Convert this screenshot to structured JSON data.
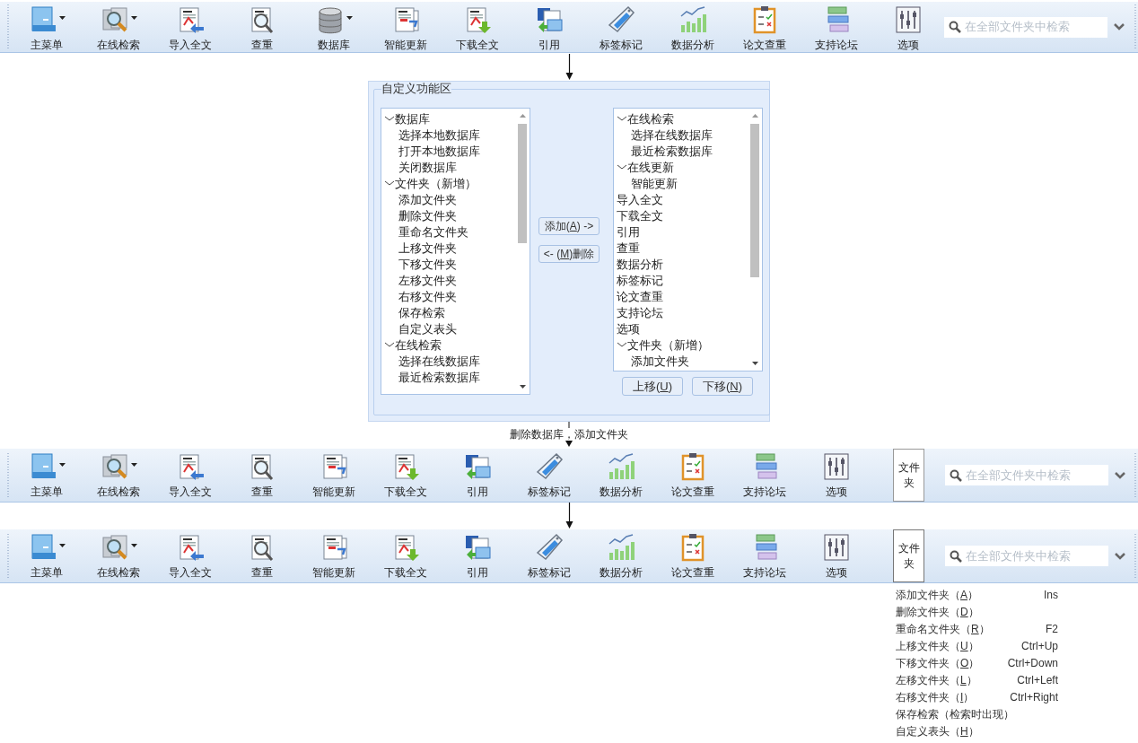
{
  "toolbars": [
    {
      "items": [
        {
          "kind": "menu",
          "label": "主菜单",
          "dropdown": true
        },
        {
          "kind": "online",
          "label": "在线检索",
          "dropdown": true
        },
        {
          "kind": "import",
          "label": "导入全文",
          "dropdown": false
        },
        {
          "kind": "check",
          "label": "查重",
          "dropdown": false
        },
        {
          "kind": "database",
          "label": "数据库",
          "dropdown": true
        },
        {
          "kind": "update",
          "label": "智能更新",
          "dropdown": false
        },
        {
          "kind": "download",
          "label": "下载全文",
          "dropdown": false
        },
        {
          "kind": "cite",
          "label": "引用",
          "dropdown": false
        },
        {
          "kind": "tag",
          "label": "标签标记",
          "dropdown": false
        },
        {
          "kind": "analysis",
          "label": "数据分析",
          "dropdown": false
        },
        {
          "kind": "paper",
          "label": "论文查重",
          "dropdown": false
        },
        {
          "kind": "forum",
          "label": "支持论坛",
          "dropdown": false
        },
        {
          "kind": "options",
          "label": "选项",
          "dropdown": false
        }
      ],
      "search": {
        "placeholder": "在全部文件夹中检索"
      }
    },
    {
      "items": [
        {
          "kind": "menu",
          "label": "主菜单",
          "dropdown": true
        },
        {
          "kind": "online",
          "label": "在线检索",
          "dropdown": true
        },
        {
          "kind": "import",
          "label": "导入全文",
          "dropdown": false
        },
        {
          "kind": "check",
          "label": "查重",
          "dropdown": false
        },
        {
          "kind": "update",
          "label": "智能更新",
          "dropdown": false
        },
        {
          "kind": "download",
          "label": "下载全文",
          "dropdown": false
        },
        {
          "kind": "cite",
          "label": "引用",
          "dropdown": false
        },
        {
          "kind": "tag",
          "label": "标签标记",
          "dropdown": false
        },
        {
          "kind": "analysis",
          "label": "数据分析",
          "dropdown": false
        },
        {
          "kind": "paper",
          "label": "论文查重",
          "dropdown": false
        },
        {
          "kind": "forum",
          "label": "支持论坛",
          "dropdown": false
        },
        {
          "kind": "options",
          "label": "选项",
          "dropdown": false
        }
      ],
      "folder_button": {
        "label": "文件夹",
        "expanded": false
      },
      "search": {
        "placeholder": "在全部文件夹中检索"
      }
    },
    {
      "items": [
        {
          "kind": "menu",
          "label": "主菜单",
          "dropdown": true
        },
        {
          "kind": "online",
          "label": "在线检索",
          "dropdown": true
        },
        {
          "kind": "import",
          "label": "导入全文",
          "dropdown": false
        },
        {
          "kind": "check",
          "label": "查重",
          "dropdown": false
        },
        {
          "kind": "update",
          "label": "智能更新",
          "dropdown": false
        },
        {
          "kind": "download",
          "label": "下载全文",
          "dropdown": false
        },
        {
          "kind": "cite",
          "label": "引用",
          "dropdown": false
        },
        {
          "kind": "tag",
          "label": "标签标记",
          "dropdown": false
        },
        {
          "kind": "analysis",
          "label": "数据分析",
          "dropdown": false
        },
        {
          "kind": "paper",
          "label": "论文查重",
          "dropdown": false
        },
        {
          "kind": "forum",
          "label": "支持论坛",
          "dropdown": false
        },
        {
          "kind": "options",
          "label": "选项",
          "dropdown": false
        }
      ],
      "folder_button": {
        "label": "文件夹",
        "expanded": true,
        "menu": [
          {
            "prefix": "添加文件夹（",
            "mnemonic": "A",
            "suffix": "）",
            "shortcut": "Ins"
          },
          {
            "prefix": "删除文件夹（",
            "mnemonic": "D",
            "suffix": "）"
          },
          {
            "prefix": "重命名文件夹（",
            "mnemonic": "R",
            "suffix": "）",
            "shortcut": "F2"
          },
          {
            "prefix": "上移文件夹（",
            "mnemonic": "U",
            "suffix": "）",
            "shortcut": "Ctrl+Up"
          },
          {
            "prefix": "下移文件夹（",
            "mnemonic": "O",
            "suffix": "）",
            "shortcut": "Ctrl+Down"
          },
          {
            "prefix": "左移文件夹（",
            "mnemonic": "L",
            "suffix": "）",
            "shortcut": "Ctrl+Left"
          },
          {
            "prefix": "右移文件夹（",
            "mnemonic": "I",
            "suffix": "）",
            "shortcut": "Ctrl+Right"
          },
          {
            "prefix": "保存检索（检索时出现）"
          },
          {
            "prefix": "自定义表头（",
            "mnemonic": "H",
            "suffix": "）"
          }
        ]
      },
      "search": {
        "placeholder": "在全部文件夹中检索"
      }
    }
  ],
  "dialog": {
    "title": "自定义功能区",
    "available": [
      {
        "label": "数据库",
        "expanded": true,
        "children": [
          {
            "label": "选择本地数据库"
          },
          {
            "label": "打开本地数据库"
          },
          {
            "label": "关闭数据库"
          }
        ]
      },
      {
        "label": "文件夹（新增）",
        "expanded": true,
        "children": [
          {
            "label": "添加文件夹"
          },
          {
            "label": "删除文件夹"
          },
          {
            "label": "重命名文件夹"
          },
          {
            "label": "上移文件夹"
          },
          {
            "label": "下移文件夹"
          },
          {
            "label": "左移文件夹"
          },
          {
            "label": "右移文件夹"
          },
          {
            "label": "保存检索"
          },
          {
            "label": "自定义表头"
          }
        ]
      },
      {
        "label": "在线检索",
        "expanded": true,
        "children": [
          {
            "label": "选择在线数据库"
          },
          {
            "label": "最近检索数据库"
          }
        ]
      }
    ],
    "chosen": [
      {
        "label": "在线检索",
        "expanded": true,
        "children": [
          {
            "label": "选择在线数据库"
          },
          {
            "label": "最近检索数据库"
          }
        ]
      },
      {
        "label": "在线更新",
        "expanded": true,
        "children": [
          {
            "label": "智能更新"
          }
        ]
      },
      {
        "label": "导入全文"
      },
      {
        "label": "下载全文"
      },
      {
        "label": "引用"
      },
      {
        "label": "查重"
      },
      {
        "label": "数据分析"
      },
      {
        "label": "标签标记"
      },
      {
        "label": "论文查重"
      },
      {
        "label": "支持论坛"
      },
      {
        "label": "选项"
      },
      {
        "label": "文件夹（新增）",
        "expanded": true,
        "children": [
          {
            "label": "添加文件夹"
          }
        ]
      }
    ],
    "add_button": {
      "prefix": "添加(",
      "mnemonic": "A",
      "suffix": ") ->"
    },
    "remove_button": {
      "prefix": "<- (",
      "mnemonic": "M",
      "suffix": ")删除"
    },
    "up_button": {
      "prefix": "上移(",
      "mnemonic": "U",
      "suffix": ")"
    },
    "down_button": {
      "prefix": "下移(",
      "mnemonic": "N",
      "suffix": ")"
    }
  },
  "change_note": "删除数据库，添加文件夹"
}
